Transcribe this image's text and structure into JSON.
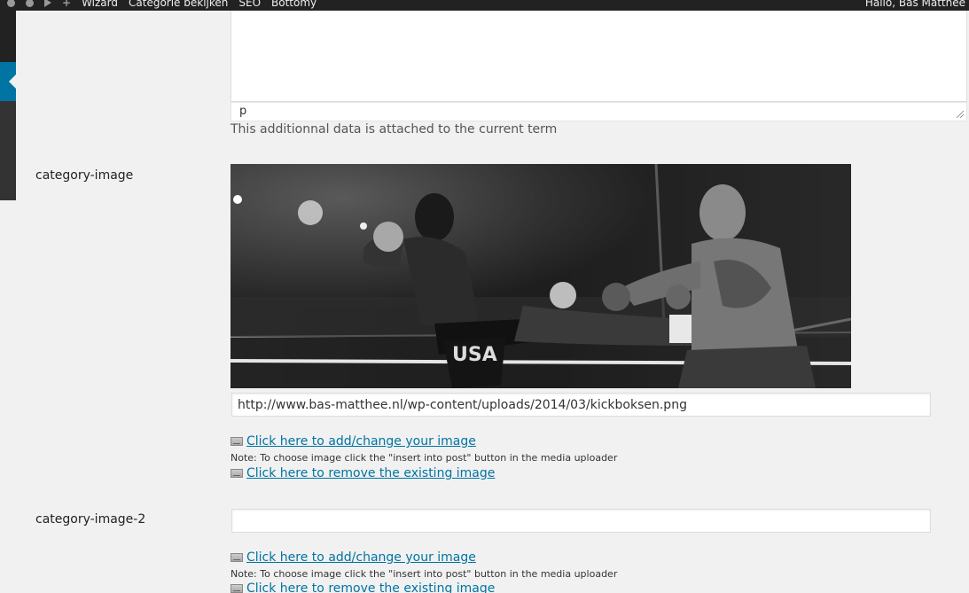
{
  "admin_bar": {
    "items": [
      "Wizard",
      "Categorie bekijken",
      "SEO",
      "Bottomy"
    ],
    "greeting": "Hallo, Bas Matthee"
  },
  "description": {
    "path_label": "p",
    "help_text": "This additionnal data is attached to the current term"
  },
  "fields": [
    {
      "label": "category-image",
      "url_value": "http://www.bas-matthee.nl/wp-content/uploads/2014/03/kickboksen.png",
      "add_link": "Click here to add/change your image ",
      "note": "Note: To choose image click the \"insert into post\" button in the media uploader",
      "remove_link": "Click here to remove the existing image "
    },
    {
      "label": "category-image-2",
      "url_value": "",
      "add_link": "Click here to add/change your image ",
      "note": "Note: To choose image click the \"insert into post\" button in the media uploader",
      "remove_link": "Click here to remove the existing image "
    }
  ]
}
